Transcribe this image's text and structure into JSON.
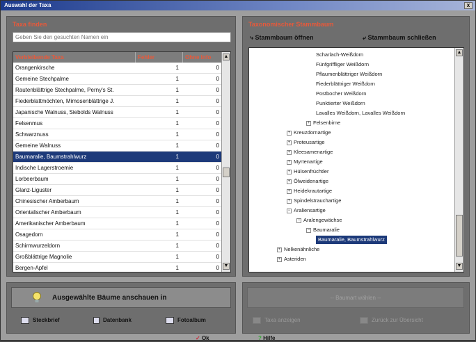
{
  "window": {
    "title": "Auswahl der Taxa",
    "close_label": "x"
  },
  "left": {
    "title": "Taxa finden",
    "search_placeholder": "Geben Sie den gesuchten Namen ein",
    "columns": [
      "Verbleibende Taxa",
      "Fehler",
      "Ohne Info"
    ],
    "rows": [
      {
        "name": "Orangenkirsche",
        "fehler": "1",
        "ohne": "0"
      },
      {
        "name": "Gemeine Stechpalme",
        "fehler": "1",
        "ohne": "0"
      },
      {
        "name": "Rautenblättrige Stechpalme, Perny's St.",
        "fehler": "1",
        "ohne": "0"
      },
      {
        "name": "Fiederblattmöchten, Mimosenblättrige J.",
        "fehler": "1",
        "ohne": "0"
      },
      {
        "name": "Japanische Walnuss, Siebolds Walnuss",
        "fehler": "1",
        "ohne": "0"
      },
      {
        "name": "Felsenmus",
        "fehler": "1",
        "ohne": "0"
      },
      {
        "name": "Schwarznuss",
        "fehler": "1",
        "ohne": "0"
      },
      {
        "name": "Gemeine Walnuss",
        "fehler": "1",
        "ohne": "0"
      },
      {
        "name": "Baumaralie, Baumstrahlwurz",
        "fehler": "1",
        "ohne": "0"
      },
      {
        "name": "Indische Lagerstroemie",
        "fehler": "1",
        "ohne": "0"
      },
      {
        "name": "Lorbeerbaum",
        "fehler": "1",
        "ohne": "0"
      },
      {
        "name": "Glanz-Liguster",
        "fehler": "1",
        "ohne": "0"
      },
      {
        "name": "Chinesischer Amberbaum",
        "fehler": "1",
        "ohne": "0"
      },
      {
        "name": "Orientalischer Amberbaum",
        "fehler": "1",
        "ohne": "0"
      },
      {
        "name": "Amerikanischer Amberbaum",
        "fehler": "1",
        "ohne": "0"
      },
      {
        "name": "Osagedorn",
        "fehler": "1",
        "ohne": "0"
      },
      {
        "name": "Schirmwurzeldorn",
        "fehler": "1",
        "ohne": "0"
      },
      {
        "name": "Großblättrige Magnolie",
        "fehler": "1",
        "ohne": "0"
      },
      {
        "name": "Bergen-Apfel",
        "fehler": "1",
        "ohne": "0"
      }
    ]
  },
  "right": {
    "title": "Taxonomischer Stammbaum",
    "open_label": "Stammbaum öffnen",
    "close_label": "Stammbaum schließen",
    "tree": [
      {
        "label": "Scharlach-Weißdorn",
        "indent": 4,
        "pm": ""
      },
      {
        "label": "Fünfgriffliger Weißdorn",
        "indent": 4,
        "pm": ""
      },
      {
        "label": "Pflaumenblättriger Weißdorn",
        "indent": 4,
        "pm": ""
      },
      {
        "label": "Fiederblättriger Weißdorn",
        "indent": 4,
        "pm": ""
      },
      {
        "label": "Postbocher Weißdorn",
        "indent": 4,
        "pm": ""
      },
      {
        "label": "Punktierter Weißdorn",
        "indent": 4,
        "pm": ""
      },
      {
        "label": "Lavalles Weißdorn, Lavalles Weißdorn",
        "indent": 4,
        "pm": ""
      },
      {
        "label": "Felsenbirne",
        "indent": 3,
        "pm": "+"
      },
      {
        "label": "Kreuzdornartige",
        "indent": 1,
        "pm": "+"
      },
      {
        "label": "Proteusartige",
        "indent": 1,
        "pm": "+"
      },
      {
        "label": "Kleesamenartige",
        "indent": 1,
        "pm": "+"
      },
      {
        "label": "Myrtenartige",
        "indent": 1,
        "pm": "+"
      },
      {
        "label": "Hülsenfrüchtler",
        "indent": 1,
        "pm": "+"
      },
      {
        "label": "Ölweidenartige",
        "indent": 1,
        "pm": "+"
      },
      {
        "label": "Heidekrautartige",
        "indent": 1,
        "pm": "+"
      },
      {
        "label": "Spindelstrauchartige",
        "indent": 1,
        "pm": "+"
      },
      {
        "label": "Araliensartige",
        "indent": 1,
        "pm": "−"
      },
      {
        "label": "Aralengewächse",
        "indent": 2,
        "pm": "−"
      },
      {
        "label": "Baumaralie",
        "indent": 3,
        "pm": "−"
      },
      {
        "label": "Baumaralie, Baumstrahlwurz",
        "indent": 4,
        "pm": "",
        "selected": true
      },
      {
        "label": "Nelkenähnliche",
        "indent": 0,
        "pm": "+"
      },
      {
        "label": "Asteriden",
        "indent": 0,
        "pm": "+"
      }
    ]
  },
  "bottom_left": {
    "main_button": "Ausgewählte Bäume anschauen in",
    "sources": [
      "Steckbrief",
      "Datenbank",
      "Fotoalbum"
    ]
  },
  "bottom_right": {
    "main_button": "-- Baumart wählen --",
    "options": [
      "Taxa anzeigen",
      "Zurück zur Übersicht"
    ]
  },
  "footer": {
    "ok_label": "Ok",
    "help_label": "Hilfe"
  },
  "colors": {
    "accent": "#e8593a",
    "selection": "#1d3a7a",
    "panel": "#6e6e6e"
  }
}
